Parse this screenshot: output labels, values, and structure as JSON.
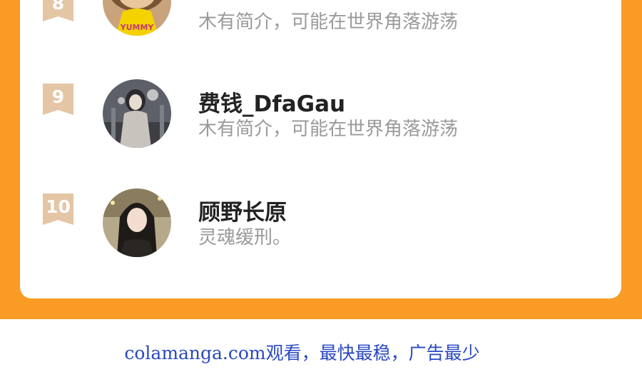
{
  "ranking": [
    {
      "rank": "8",
      "name": "",
      "bio": "木有简介，可能在世界角落游荡",
      "avatar_text": "YUMMY"
    },
    {
      "rank": "9",
      "name": "费钱_DfaGau",
      "bio": "木有简介，可能在世界角落游荡"
    },
    {
      "rank": "10",
      "name": "顾野长原",
      "bio": "灵魂缓刑。"
    }
  ],
  "footer": {
    "text": "colamanga.com观看，最快最稳，广告最少"
  },
  "colors": {
    "accent": "#f99b24",
    "badge": "#e4c5a5",
    "footer_text": "#2a48c0"
  }
}
